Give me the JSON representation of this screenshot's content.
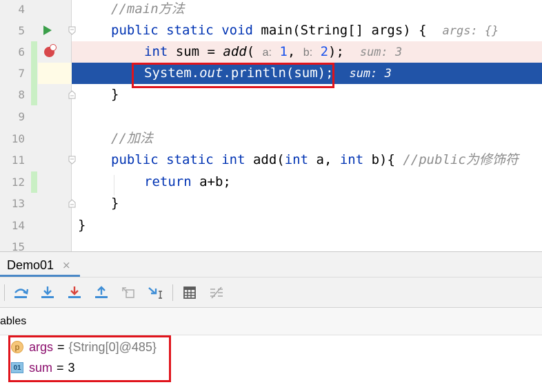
{
  "editor": {
    "lines": [
      {
        "num": "4"
      },
      {
        "num": "5"
      },
      {
        "num": "6"
      },
      {
        "num": "7"
      },
      {
        "num": "8"
      },
      {
        "num": "9"
      },
      {
        "num": "10"
      },
      {
        "num": "11"
      },
      {
        "num": "12"
      },
      {
        "num": "13"
      },
      {
        "num": "14"
      },
      {
        "num": "15"
      }
    ],
    "code": {
      "l4_comment": "//main方法",
      "l5_public": "public",
      "l5_static": "static",
      "l5_void": "void",
      "l5_rest": "main(String[] args) {",
      "l5_inline": "args: {}",
      "l6_int": "int",
      "l6_sum": "sum = ",
      "l6_add": "add",
      "l6_paren": "(",
      "l6_hint_a": "a:",
      "l6_arg1": "1",
      "l6_comma": ", ",
      "l6_hint_b": "b:",
      "l6_arg2": "2",
      "l6_end": ");",
      "l6_inline": "sum: 3",
      "l7_system": "System.",
      "l7_out": "out",
      "l7_rest": ".println(sum);",
      "l7_inline": "sum: 3",
      "l8_brace": "}",
      "l10_comment": "//加法",
      "l11_public": "public",
      "l11_static": "static",
      "l11_int": "int",
      "l11_add": "add(",
      "l11_int2": "int",
      "l11_a": " a, ",
      "l11_int3": "int",
      "l11_b": " b){ ",
      "l11_comment": "//public为修饰符",
      "l12_return": "return",
      "l12_rest": " a+b;",
      "l13_brace": "}",
      "l14_brace": "}"
    }
  },
  "debug": {
    "tab_label": "Demo01",
    "tab_close": "×",
    "variables_header": "ables",
    "variables": [
      {
        "name": "args",
        "eq": "=",
        "value": "{String[0]@485}",
        "icon": "p"
      },
      {
        "name": "sum",
        "eq": "=",
        "value": "3",
        "icon": "01"
      }
    ],
    "toolbar_buttons": [
      "step-over-icon",
      "step-into-icon",
      "force-step-into-icon",
      "step-out-icon",
      "drop-frame-icon",
      "run-to-cursor-icon",
      "evaluate-expression-icon",
      "trace-icon"
    ]
  },
  "colors": {
    "execution_line": "#2154a8",
    "breakpoint_line": "#fae9e7",
    "highlight_box": "#e0141c",
    "keyword": "#0033b3"
  }
}
